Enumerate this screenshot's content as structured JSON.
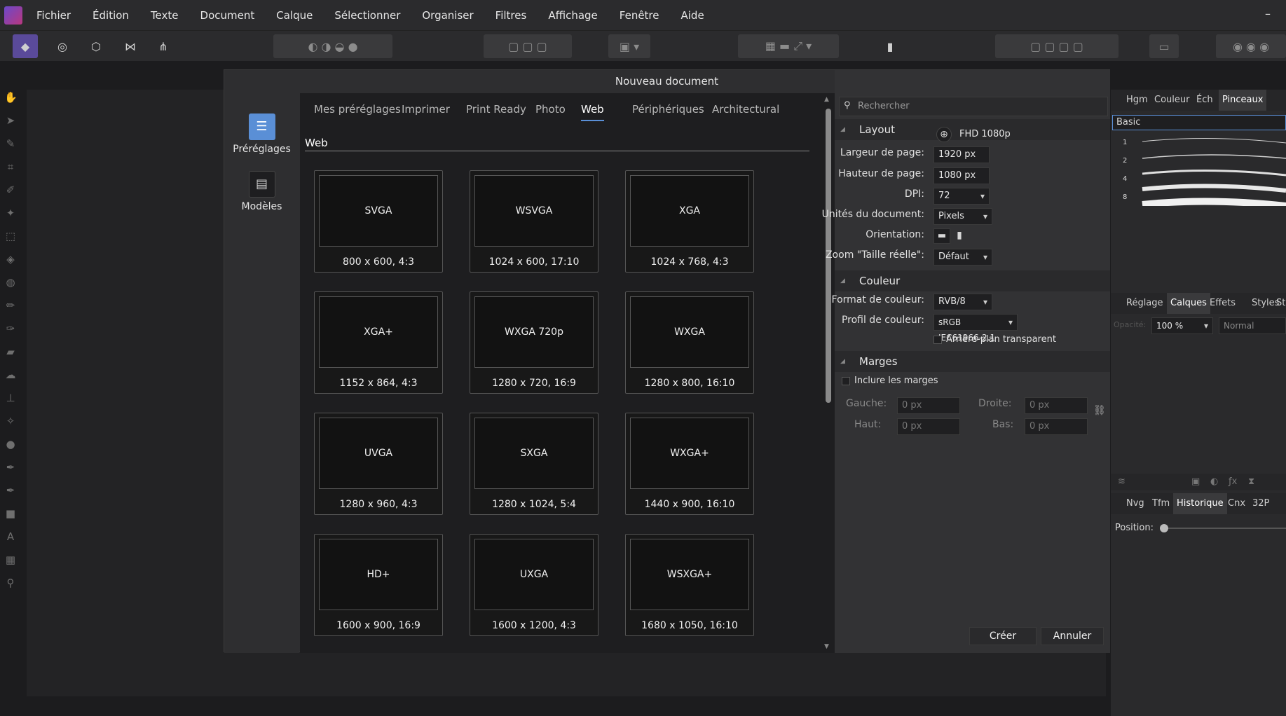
{
  "menubar": {
    "items": [
      "Fichier",
      "Édition",
      "Texte",
      "Document",
      "Calque",
      "Sélectionner",
      "Organiser",
      "Filtres",
      "Affichage",
      "Fenêtre",
      "Aide"
    ]
  },
  "dialog": {
    "title": "Nouveau document",
    "close": "×",
    "sidebar": [
      {
        "label": "Préréglages",
        "active": true
      },
      {
        "label": "Modèles",
        "active": false
      }
    ],
    "tabs": [
      "Mes préréglages",
      "Imprimer",
      "Print Ready",
      "Photo",
      "Web",
      "Périphériques",
      "Architectural"
    ],
    "active_tab": "Web",
    "group_label": "Web",
    "presets": [
      {
        "name": "SVGA",
        "size": "800 x 600, 4:3"
      },
      {
        "name": "WSVGA",
        "size": "1024 x 600, 17:10"
      },
      {
        "name": "XGA",
        "size": "1024 x 768, 4:3"
      },
      {
        "name": "XGA+",
        "size": "1152 x 864, 4:3"
      },
      {
        "name": "WXGA 720p",
        "size": "1280 x 720, 16:9"
      },
      {
        "name": "WXGA",
        "size": "1280 x 800, 16:10"
      },
      {
        "name": "UVGA",
        "size": "1280 x 960, 4:3"
      },
      {
        "name": "SXGA",
        "size": "1280 x 1024, 5:4"
      },
      {
        "name": "WXGA+",
        "size": "1440 x 900, 16:10"
      },
      {
        "name": "HD+",
        "size": "1600 x 900, 16:9"
      },
      {
        "name": "UXGA",
        "size": "1600 x 1200, 4:3"
      },
      {
        "name": "WSXGA+",
        "size": "1680 x 1050, 16:10"
      }
    ],
    "search_placeholder": "Rechercher",
    "layout": {
      "section": "Layout",
      "preset_name": "FHD 1080p",
      "width_label": "Largeur de page:",
      "width": "1920 px",
      "height_label": "Hauteur de page:",
      "height": "1080 px",
      "dpi_label": "DPI:",
      "dpi": "72",
      "units_label": "Unités du document:",
      "units": "Pixels",
      "orientation_label": "Orientation:",
      "zoom_label": "Zoom \"Taille réelle\":",
      "zoom": "Défaut"
    },
    "color": {
      "section": "Couleur",
      "format_label": "Format de couleur:",
      "format": "RVB/8",
      "profile_label": "Profil de couleur:",
      "profile": "sRGB IEC61966-2.1",
      "transparent_label": "Arrière-plan transparent"
    },
    "margins": {
      "section": "Marges",
      "include_label": "Inclure les marges",
      "left_label": "Gauche:",
      "left": "0 px",
      "right_label": "Droite:",
      "right": "0 px",
      "top_label": "Haut:",
      "top": "0 px",
      "bottom_label": "Bas:",
      "bottom": "0 px"
    },
    "create": "Créer",
    "cancel": "Annuler"
  },
  "right_panel": {
    "tabs1": [
      "Hgm",
      "Couleur",
      "Éch",
      "Pinceaux"
    ],
    "brush_category": "Basic",
    "brush_sizes": [
      "1",
      "2",
      "4",
      "8"
    ],
    "tabs2": [
      "Réglage",
      "Calques",
      "Effets",
      "Styles",
      "Sto"
    ],
    "opacity_label": "Opacité:",
    "opacity": "100 %",
    "blend": "Normal",
    "tabs3": [
      "Nvg",
      "Tfm",
      "Historique",
      "Cnx",
      "32P"
    ],
    "position_label": "Position:"
  },
  "colors": {
    "accent": "#5a8fd6",
    "menubar": "#2b2b2d",
    "dialog": "#2e2e30",
    "grid_bg": "#1e1e20"
  }
}
